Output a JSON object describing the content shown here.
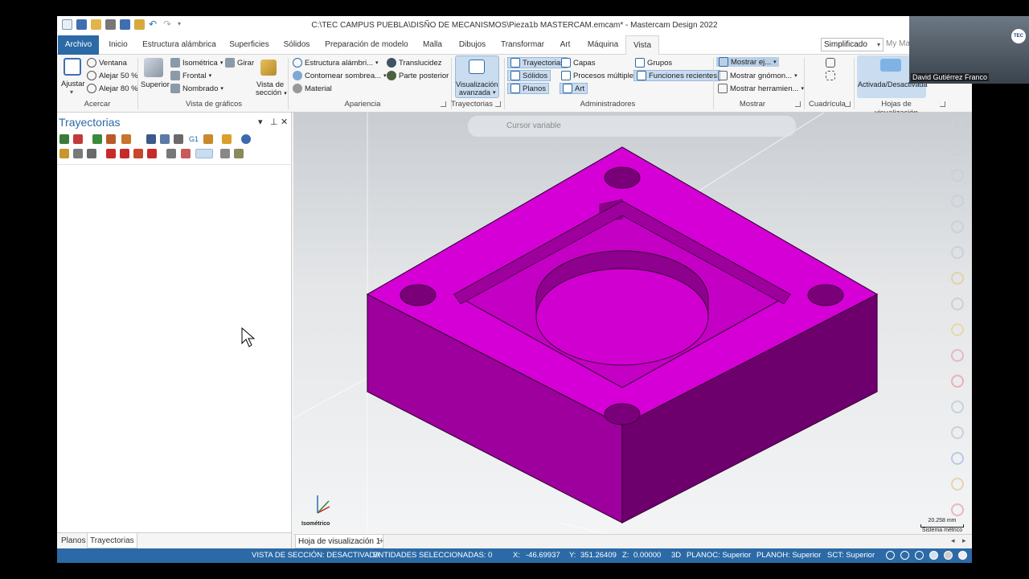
{
  "window": {
    "title": "C:\\TEC CAMPUS PUEBLA\\DISÑO DE MECANISMOS\\Pieza1b MASTERCAM.emcam* - Mastercam Design 2022"
  },
  "tabs": [
    "Archivo",
    "Inicio",
    "Estructura alámbrica",
    "Superficies",
    "Sólidos",
    "Preparación de modelo",
    "Malla",
    "Dibujos",
    "Transformar",
    "Art",
    "Máquina",
    "Vista"
  ],
  "active_tab": "Vista",
  "search": {
    "value": "Simplificado",
    "extra": "My Mas"
  },
  "ribbon": {
    "zoom": {
      "fit": "Ajustar",
      "window": "Ventana",
      "out50": "Alejar 50 %",
      "out80": "Alejar 80 %",
      "label": "Acercar"
    },
    "graphics_view": {
      "top": "Superior",
      "isometric": "Isométrica",
      "front": "Frontal",
      "named": "Nombrado",
      "rotate": "Girar",
      "section1": "Vista de",
      "section2": "sección",
      "label": "Vista de gráficos"
    },
    "appearance": {
      "wireframe": "Estructura alámbri...",
      "shaded": "Contornear sombrea...",
      "material": "Material",
      "translucency": "Translucidez",
      "backside": "Parte posterior",
      "label": "Apariencia"
    },
    "toolpaths": {
      "adv1": "Visualización",
      "adv2": "avanzada",
      "label": "Trayectorias"
    },
    "managers": {
      "toolpaths": "Trayectorias",
      "solids": "Sólidos",
      "planes": "Planos",
      "levels": "Capas",
      "multithreading": "Procesos múltiples",
      "art": "Art",
      "groups": "Grupos",
      "recent": "Funciones recientes",
      "label": "Administradores"
    },
    "display": {
      "show_axes": "Mostrar ej...",
      "show_gnomon": "Mostrar gnómon...",
      "show_tool": "Mostrar herramien...",
      "label": "Mostrar"
    },
    "grid": {
      "label": "Cuadrícula"
    },
    "viewsheets": {
      "toggle": "Activada/Desactivada",
      "label": "Hojas de visualización"
    }
  },
  "left_panel": {
    "title": "Trayectorias",
    "bottom_tabs": [
      "Planos",
      "Trayectorias"
    ],
    "active_bottom_tab": "Trayectorias"
  },
  "viewport": {
    "float_toolbar_label": "Cursor variable",
    "view_label": "Isométrico",
    "scale_value": "20.258 mm",
    "scale_units": "Sistema métrico",
    "axes": {
      "x": "X",
      "y": "Y",
      "z": "Z"
    },
    "part_color": "#d500d5"
  },
  "sheet_tab": "Hoja de visualización 1",
  "status": {
    "section_view": "VISTA DE SECCIÓN: DESACTIVADA",
    "selected": "ENTIDADES SELECCIONADAS: 0",
    "x_label": "X:",
    "x": "-46.69937",
    "y_label": "Y:",
    "y": "351.26409",
    "z_label": "Z:",
    "z": "0.00000",
    "mode": "3D",
    "cplane": "PLANOC: Superior",
    "tplane": "PLANOH: Superior",
    "wcs": "SCT: Superior"
  },
  "webcam": {
    "name": "David Gutiérrez Franco",
    "logo": "TEC"
  }
}
